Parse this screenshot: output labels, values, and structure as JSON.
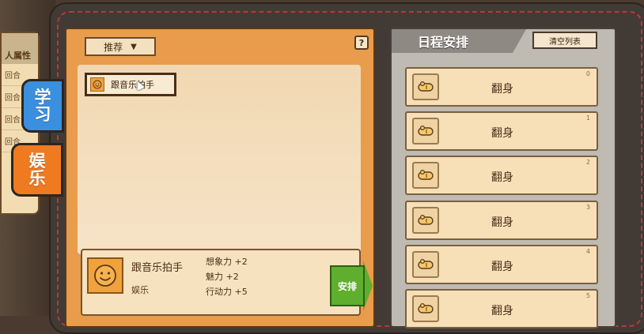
{
  "side_panel": {
    "header": "人属性",
    "rows": [
      "回合",
      "回合",
      "回合",
      "回合"
    ]
  },
  "tabs": [
    {
      "label": "学\n习"
    },
    {
      "label": "娱\n乐"
    }
  ],
  "left_panel": {
    "filter_label": "推荐",
    "help_label": "?",
    "activities": [
      {
        "name": "跟音乐拍手"
      }
    ],
    "detail": {
      "name": "跟音乐拍手",
      "category": "娱乐",
      "effects": [
        "想象力 +2",
        "魅力 +2",
        "行动力 +5"
      ],
      "arrange_label": "安排"
    }
  },
  "right_panel": {
    "title": "日程安排",
    "clear_label": "清空列表",
    "items": [
      {
        "label": "翻身",
        "num": "0"
      },
      {
        "label": "翻身",
        "num": "1"
      },
      {
        "label": "翻身",
        "num": "2"
      },
      {
        "label": "翻身",
        "num": "3"
      },
      {
        "label": "翻身",
        "num": "4"
      },
      {
        "label": "翻身",
        "num": "5"
      }
    ]
  }
}
